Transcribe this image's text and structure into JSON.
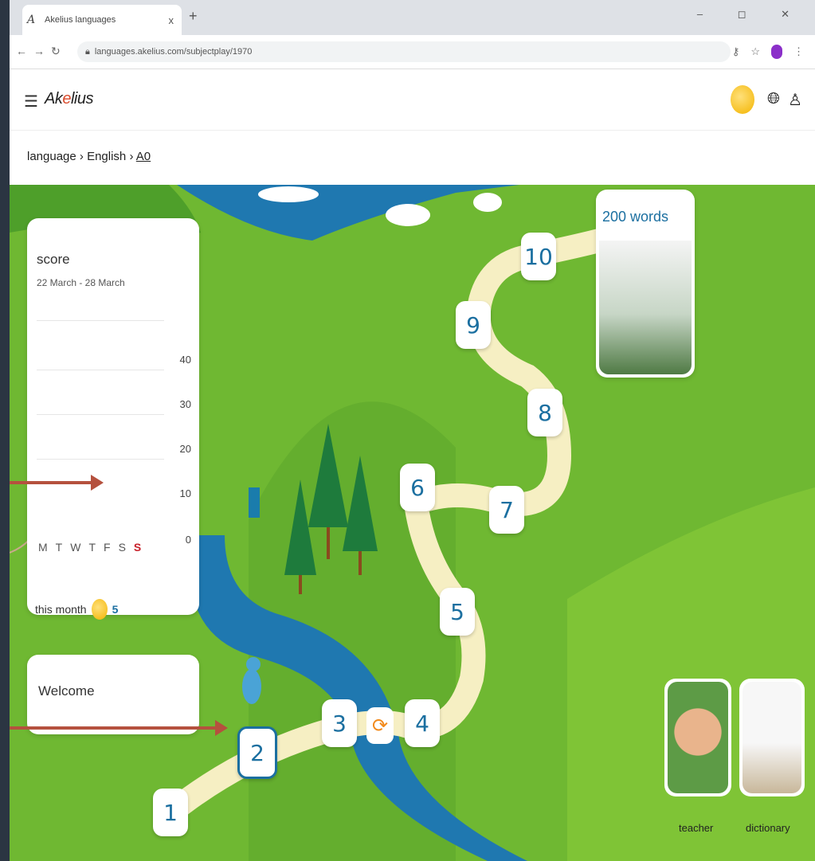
{
  "browser": {
    "tab_title": "Akelius languages",
    "tab_close": "x",
    "new_tab": "+",
    "url": "languages.akelius.com/subjectplay/1970"
  },
  "header": {
    "logo_prefix": "Ak",
    "logo_accent": "e",
    "logo_suffix": "lius"
  },
  "breadcrumb": {
    "items": [
      "language",
      "English",
      "A0"
    ],
    "separator": "›"
  },
  "score_panel": {
    "title": "score",
    "date_range": "22 March - 28 March",
    "y_ticks": [
      "40",
      "30",
      "20",
      "10",
      "0"
    ],
    "days": [
      "M",
      "T",
      "W",
      "T",
      "F",
      "S",
      "S"
    ],
    "day_values": [
      0,
      0,
      0,
      0,
      0,
      0,
      5
    ],
    "ymax": 40,
    "month_label": "this month",
    "month_value": "5"
  },
  "welcome": {
    "title": "Welcome"
  },
  "goal": {
    "title": "200 words"
  },
  "path": {
    "steps": [
      "1",
      "2",
      "3",
      "4",
      "5",
      "6",
      "7",
      "8",
      "9",
      "10"
    ],
    "active_step": "2"
  },
  "tools": {
    "teacher_label": "teacher",
    "dictionary_label": "dictionary"
  },
  "colors": {
    "brand_blue": "#1b6fa0",
    "map_green": "#6fb832",
    "river": "#1f78b0",
    "path": "#f6efc3"
  }
}
